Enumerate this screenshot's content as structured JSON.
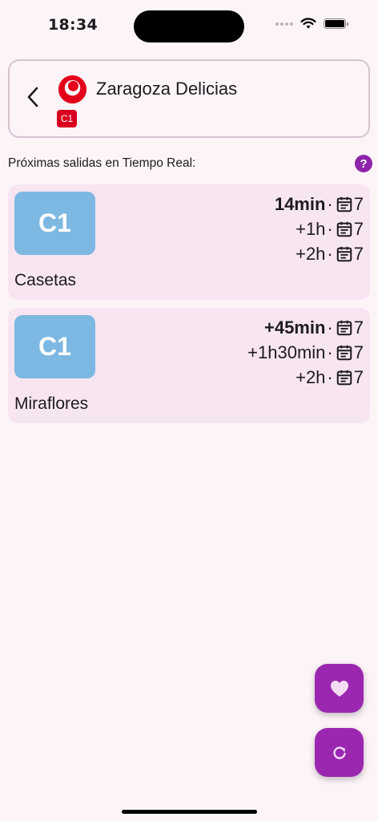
{
  "status": {
    "time": "18:34"
  },
  "header": {
    "station_name": "Zaragoza Delicias",
    "line_badge": "C1"
  },
  "section": {
    "label": "Próximas salidas en Tiempo Real:",
    "help_label": "?"
  },
  "departures": [
    {
      "line": "C1",
      "destination": "Casetas",
      "times": [
        {
          "time": "14min",
          "days": "7",
          "bold": true
        },
        {
          "time": "+1h",
          "days": "7",
          "bold": false
        },
        {
          "time": "+2h",
          "days": "7",
          "bold": false
        }
      ]
    },
    {
      "line": "C1",
      "destination": "Miraflores",
      "times": [
        {
          "time": "+45min",
          "days": "7",
          "bold": true
        },
        {
          "time": "+1h30min",
          "days": "7",
          "bold": false
        },
        {
          "time": "+2h",
          "days": "7",
          "bold": false
        }
      ]
    }
  ],
  "time_separator": "·",
  "icons": {
    "back": "chevron-left-icon",
    "logo": "renfe-logo",
    "calendar": "calendar-icon",
    "favorite": "heart-icon",
    "refresh": "refresh-icon"
  },
  "colors": {
    "background": "#fdf4f8",
    "card": "#f7e6f1",
    "line_c1": "#7db8e2",
    "renfe_red": "#d8001e",
    "accent": "#9b27b0"
  }
}
